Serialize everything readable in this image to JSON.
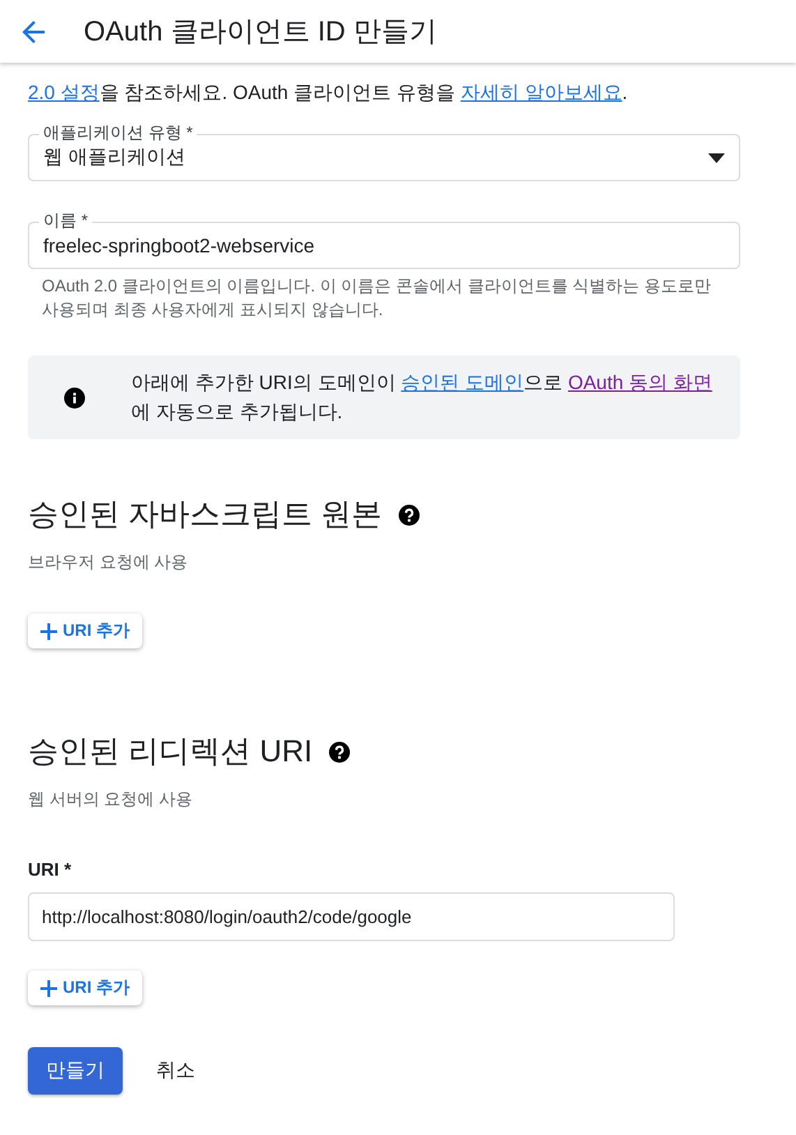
{
  "header": {
    "title": "OAuth 클라이언트 ID 만들기"
  },
  "intro": [
    {
      "kind": "link",
      "text": "2.0 설정",
      "visited": false
    },
    {
      "kind": "text",
      "text": "을 참조하세요. OAuth 클라이언트 유형을 "
    },
    {
      "kind": "link",
      "text": "자세히 알아보세요",
      "visited": false
    },
    {
      "kind": "text",
      "text": "."
    }
  ],
  "application_type": {
    "label": "애플리케이션 유형 *",
    "value": "웹 애플리케이션"
  },
  "name": {
    "label": "이름 *",
    "value": "freelec-springboot2-webservice",
    "hint": "OAuth 2.0 클라이언트의 이름입니다. 이 이름은 콘솔에서 클라이언트를 식별하는 용도로만 사용되며 최종 사용자에게 표시되지 않습니다."
  },
  "notice": [
    {
      "kind": "text",
      "text": "아래에 추가한 URI의 도메인이 "
    },
    {
      "kind": "link",
      "text": "승인된 도메인",
      "visited": false
    },
    {
      "kind": "text",
      "text": "으로 "
    },
    {
      "kind": "link",
      "text": "OAuth 동의 화면",
      "visited": true
    },
    {
      "kind": "text",
      "text": "에 자동으로 추가됩니다."
    }
  ],
  "sections": [
    {
      "title": "승인된 자바스크립트 원본",
      "subtitle": "브라우저 요청에 사용",
      "add_button": "URI 추가"
    },
    {
      "title": "승인된 리디렉션 URI",
      "subtitle": "웹 서버의 요청에 사용",
      "uris": [
        {
          "label": "URI *",
          "value": "http://localhost:8080/login/oauth2/code/google"
        }
      ],
      "add_button": "URI 추가"
    }
  ],
  "actions": {
    "create": "만들기",
    "cancel": "취소"
  }
}
